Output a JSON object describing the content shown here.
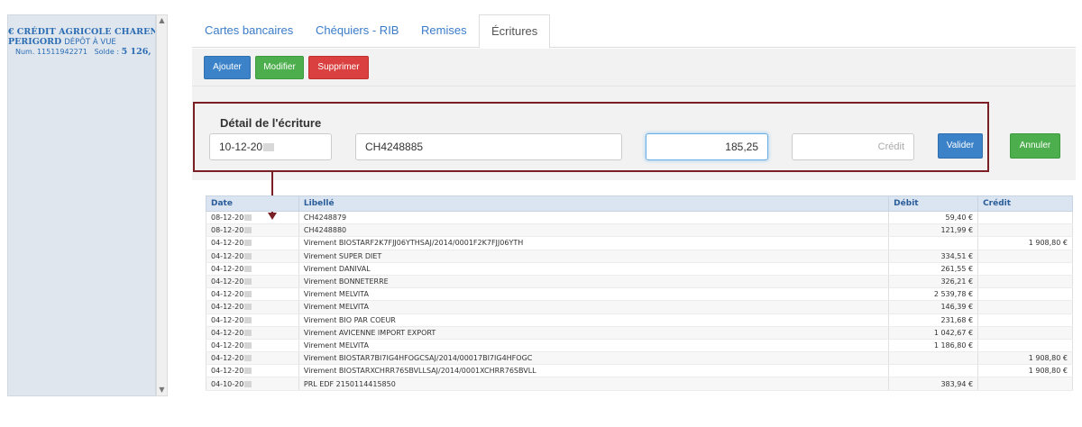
{
  "sidebar": {
    "account": {
      "bank_line1": "CRÉDIT AGRICOLE CHAREN",
      "bank_line2": "PERIGORD",
      "account_type": "DÉPÔT À VUE",
      "num_label": "Num.",
      "num_value": "11511942271",
      "solde_label": "Solde :",
      "solde_value": "5 126,"
    }
  },
  "tabs": [
    {
      "label": "Cartes bancaires",
      "active": false
    },
    {
      "label": "Chéquiers - RIB",
      "active": false
    },
    {
      "label": "Remises",
      "active": false
    },
    {
      "label": "Écritures",
      "active": true
    }
  ],
  "toolbar": {
    "add_label": "Ajouter",
    "edit_label": "Modifier",
    "delete_label": "Supprimer"
  },
  "detail": {
    "title": "Détail de l'écriture",
    "date_value": "10-12-20",
    "libelle_value": "CH4248885",
    "debit_value": "185,25",
    "credit_placeholder": "Crédit",
    "validate_label": "Valider",
    "cancel_label": "Annuler"
  },
  "table": {
    "headers": {
      "date": "Date",
      "libelle": "Libellé",
      "debit": "Débit",
      "credit": "Crédit"
    },
    "rows": [
      {
        "date": "08-12-20",
        "libelle": "CH4248879",
        "debit": "59,40 €",
        "credit": ""
      },
      {
        "date": "08-12-20",
        "libelle": "CH4248880",
        "debit": "121,99 €",
        "credit": ""
      },
      {
        "date": "04-12-20",
        "libelle": "Virement BIOSTARF2K7FJJ06YTHSAJ/2014/0001F2K7FJJ06YTH",
        "debit": "",
        "credit": "1 908,80 €"
      },
      {
        "date": "04-12-20",
        "libelle": "Virement SUPER DIET",
        "debit": "334,51 €",
        "credit": ""
      },
      {
        "date": "04-12-20",
        "libelle": "Virement DANIVAL",
        "debit": "261,55 €",
        "credit": ""
      },
      {
        "date": "04-12-20",
        "libelle": "Virement BONNETERRE",
        "debit": "326,21 €",
        "credit": ""
      },
      {
        "date": "04-12-20",
        "libelle": "Virement MELVITA",
        "debit": "2 539,78 €",
        "credit": ""
      },
      {
        "date": "04-12-20",
        "libelle": "Virement MELVITA",
        "debit": "146,39 €",
        "credit": ""
      },
      {
        "date": "04-12-20",
        "libelle": "Virement BIO PAR COEUR",
        "debit": "231,68 €",
        "credit": ""
      },
      {
        "date": "04-12-20",
        "libelle": "Virement AVICENNE IMPORT EXPORT",
        "debit": "1 042,67 €",
        "credit": ""
      },
      {
        "date": "04-12-20",
        "libelle": "Virement MELVITA",
        "debit": "1 186,80 €",
        "credit": ""
      },
      {
        "date": "04-12-20",
        "libelle": "Virement BIOSTAR7BI7IG4HFOGCSAJ/2014/00017BI7IG4HFOGC",
        "debit": "",
        "credit": "1 908,80 €"
      },
      {
        "date": "04-12-20",
        "libelle": "Virement BIOSTARXCHRR76SBVLLSAJ/2014/0001XCHRR76SBVLL",
        "debit": "",
        "credit": "1 908,80 €"
      },
      {
        "date": "04-10-20",
        "libelle": "PRL EDF 2150114415850",
        "debit": "383,94 €",
        "credit": ""
      }
    ]
  }
}
